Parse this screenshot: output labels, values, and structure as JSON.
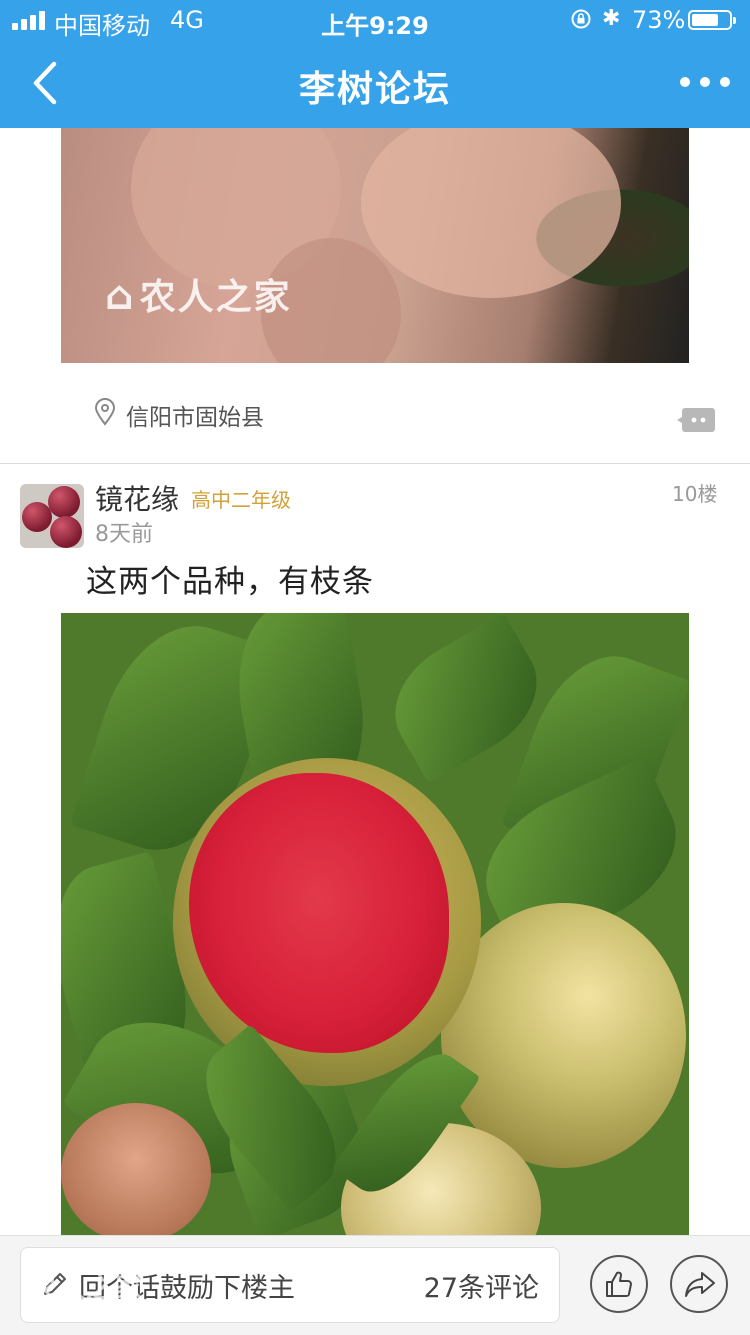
{
  "status": {
    "carrier": "中国移动",
    "network": "4G",
    "time": "上午9:29",
    "battery": "73%",
    "battery_level": 0.73
  },
  "nav": {
    "title": "李树论坛",
    "back_icon": "chevron-left-icon",
    "more_icon": "more-dots-icon"
  },
  "previous_post": {
    "image_watermark": "农人之家",
    "location": "信阳市固始县",
    "location_icon": "location-pin-icon",
    "comment_icon": "comment-icon"
  },
  "post": {
    "username": "镜花缘",
    "level": "高中二年级",
    "floor": "10楼",
    "time": "8天前",
    "text": "这两个品种，有枝条"
  },
  "bottom_bar": {
    "reply_placeholder": "回个话鼓励下楼主",
    "comment_count": "27条评论",
    "watermark": "农人之家",
    "like_icon": "thumbs-up-icon",
    "share_icon": "share-arrow-icon"
  },
  "colors": {
    "brand": "#35a2ea",
    "level": "#d2a23a"
  }
}
